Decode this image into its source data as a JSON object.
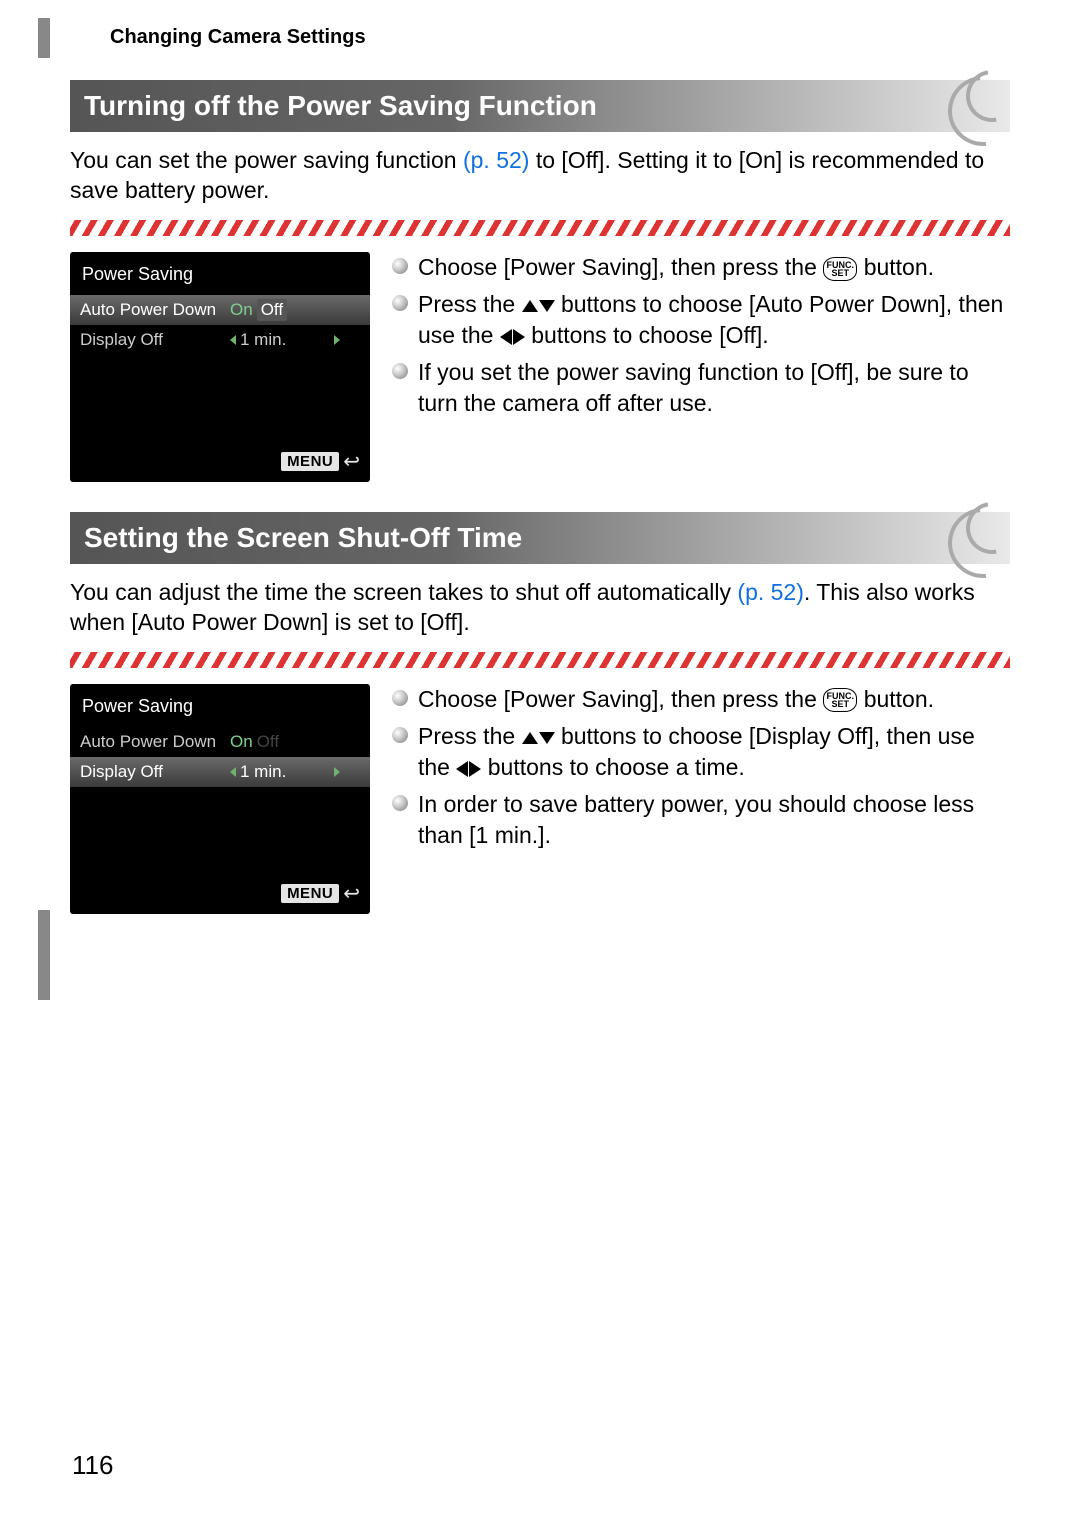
{
  "breadcrumb": "Changing Camera Settings",
  "page_number": "116",
  "section1": {
    "title": "Turning off the Power Saving Function",
    "intro_a": "You can set the power saving function ",
    "intro_ref": "(p. 52)",
    "intro_b": " to [Off]. Setting it to [On] is recommended to save battery power.",
    "screenshot": {
      "title": "Power Saving",
      "row1_label": "Auto Power Down",
      "row1_on": "On",
      "row1_off": "Off",
      "row2_label": "Display Off",
      "row2_value": "1 min.",
      "menu_label": "MENU"
    },
    "bullets": {
      "b1": "Choose [Power Saving], then press the ",
      "b1_end": " button.",
      "b2_a": "Press the ",
      "b2_b": " buttons to choose [Auto Power Down], then use the ",
      "b2_c": " buttons to choose [Off].",
      "b3": "If you set the power saving function to [Off], be sure to turn the camera off after use."
    }
  },
  "section2": {
    "title": "Setting the Screen Shut-Off Time",
    "intro_a": "You can adjust the time the screen takes to shut off automatically ",
    "intro_ref": "(p. 52)",
    "intro_b": ". This also works when [Auto Power Down] is set to [Off].",
    "screenshot": {
      "title": "Power Saving",
      "row1_label": "Auto Power Down",
      "row1_on": "On",
      "row1_off": "Off",
      "row2_label": "Display Off",
      "row2_value": "1 min.",
      "menu_label": "MENU"
    },
    "bullets": {
      "b1": "Choose [Power Saving], then press the ",
      "b1_end": " button.",
      "b2_a": "Press the ",
      "b2_b": " buttons to choose [Display Off], then use the ",
      "b2_c": " buttons to choose a time.",
      "b3": "In order to save battery power, you should choose less than [1 min.]."
    }
  },
  "func_label_top": "FUNC.",
  "func_label_bottom": "SET"
}
